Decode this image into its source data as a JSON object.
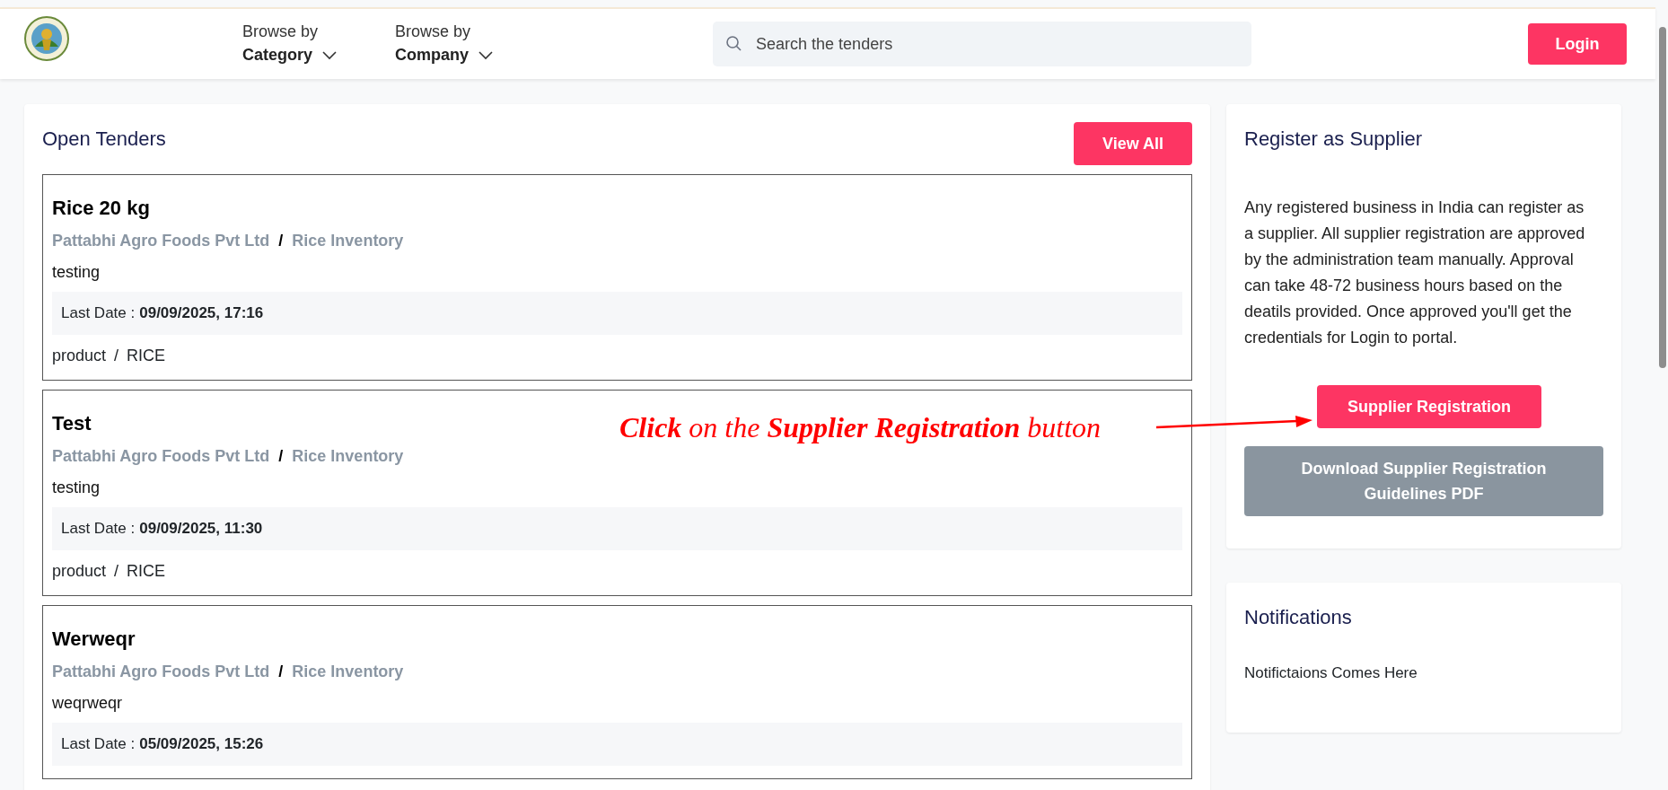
{
  "header": {
    "nav": [
      {
        "top": "Browse by",
        "label": "Category"
      },
      {
        "top": "Browse by",
        "label": "Company"
      }
    ],
    "search": {
      "placeholder": "Search the tenders"
    },
    "login": "Login"
  },
  "open_tenders": {
    "title": "Open Tenders",
    "view_all": "View All",
    "tenders": [
      {
        "title": "Rice 20 kg",
        "company": "Pattabhi Agro Foods Pvt Ltd",
        "separator": "/",
        "inventory": "Rice Inventory",
        "description": "testing",
        "last_date_label": "Last Date :",
        "last_date": "09/09/2025, 17:16",
        "type": "product",
        "type_separator": "/",
        "category": "RICE"
      },
      {
        "title": "Test",
        "company": "Pattabhi Agro Foods Pvt Ltd",
        "separator": "/",
        "inventory": "Rice Inventory",
        "description": "testing",
        "last_date_label": "Last Date :",
        "last_date": "09/09/2025, 11:30",
        "type": "product",
        "type_separator": "/",
        "category": "RICE"
      },
      {
        "title": "Werweqr",
        "company": "Pattabhi Agro Foods Pvt Ltd",
        "separator": "/",
        "inventory": "Rice Inventory",
        "description": "weqrweqr",
        "last_date_label": "Last Date :",
        "last_date": "05/09/2025, 15:26"
      }
    ]
  },
  "register": {
    "title": "Register as Supplier",
    "text": "Any registered business in India can register as a supplier. All supplier registration are approved by the administration team manually. Approval can take 48-72 business hours based on the deatils provided. Once approved you'll get the credentials for Login to portal.",
    "button": "Supplier Registration",
    "download": "Download Supplier Registration Guidelines PDF"
  },
  "notifications": {
    "title": "Notifications",
    "text": "Notifictaions Comes Here"
  },
  "annotation": {
    "text": "**Click** on the **Supplier Registration** button"
  }
}
